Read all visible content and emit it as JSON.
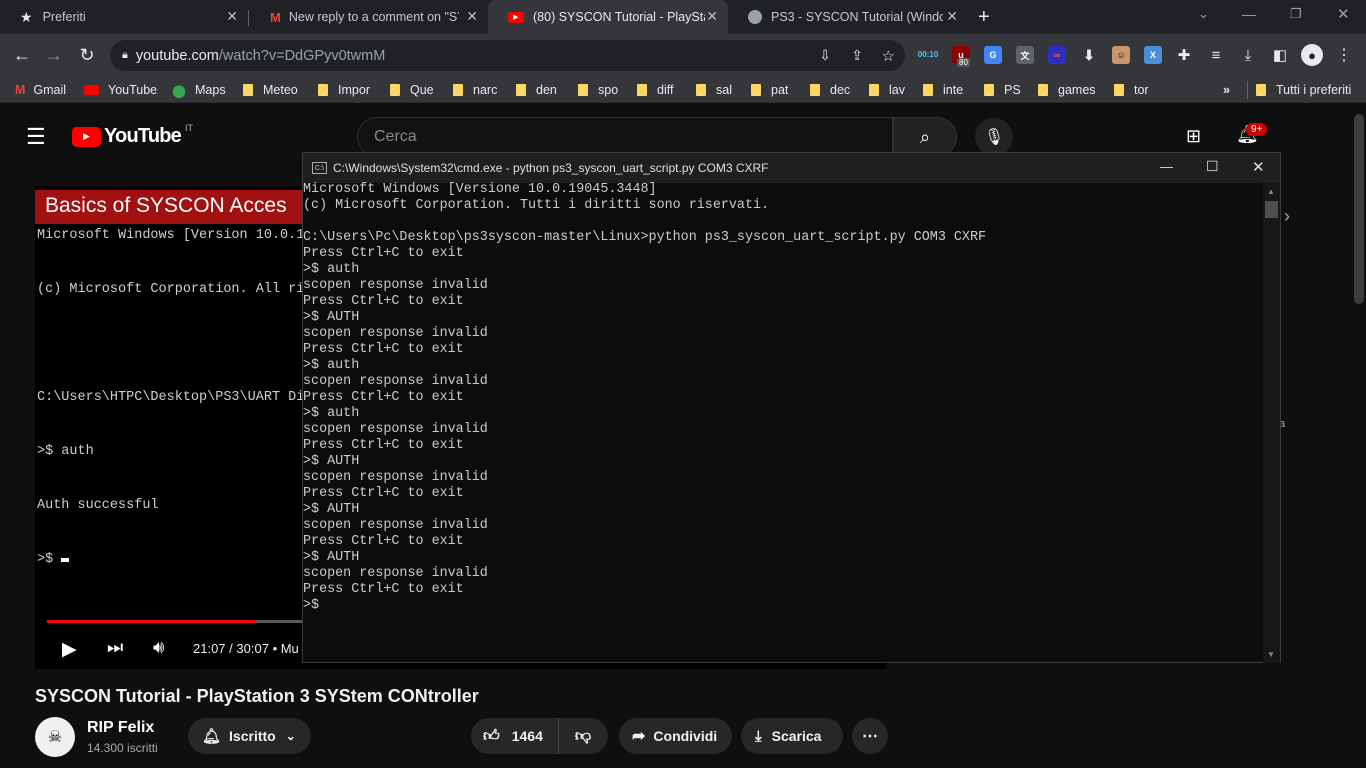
{
  "browser": {
    "tabs": [
      {
        "title": "Preferiti",
        "icon": "star-icon"
      },
      {
        "title": "New reply to a comment on \"SY",
        "icon": "gmail-icon"
      },
      {
        "title": "(80) SYSCON Tutorial - PlayStatio",
        "icon": "youtube-icon"
      },
      {
        "title": "PS3 - SYSCON Tutorial (Window",
        "icon": "globe-icon"
      }
    ],
    "new_tab": "+",
    "url_host": "youtube.com",
    "url_path": "/watch?v=DdGPyv0twmM",
    "ext_badge_timer": "00:10",
    "ext_badge_count": "80",
    "bookmarks": [
      "Gmail",
      "YouTube",
      "Maps",
      "Meteo",
      "Impor",
      "Que",
      "narc",
      "den",
      "spo",
      "diff",
      "sal",
      "pat",
      "dec",
      "lav",
      "inte",
      "PS",
      "games",
      "tor"
    ],
    "bookmarks_more": "»",
    "bookmarks_all": "Tutti i preferiti"
  },
  "youtube": {
    "logo_text": "YouTube",
    "country_code": "IT",
    "search_placeholder": "Cerca",
    "notif_badge": "9+",
    "video_overlay_title": "Basics of SYSCON Acces",
    "video_terminal_lines": [
      "Microsoft Windows [Version 10.0.1",
      "(c) Microsoft Corporation. All ri",
      "",
      "C:\\Users\\HTPC\\Desktop\\PS3\\UART Di",
      ">$ auth",
      "Auth successful",
      ">$ "
    ],
    "time_current": "21:07",
    "time_total": "30:07",
    "time_sep": " / ",
    "chapter_partial": "• Mu",
    "progress": 0.82,
    "video_title": "SYSCON Tutorial - PlayStation 3 SYStem CONtroller",
    "channel_name": "RIP Felix",
    "subscribers": "14.300 iscritti",
    "subscribed_label": "Iscritto",
    "likes": "1464",
    "share_label": "Condividi",
    "download_label": "Scarica",
    "side_fragment": "a"
  },
  "cmd": {
    "title": "C:\\Windows\\System32\\cmd.exe - python  ps3_syscon_uart_script.py COM3 CXRF",
    "lines": [
      "Microsoft Windows [Versione 10.0.19045.3448]",
      "(c) Microsoft Corporation. Tutti i diritti sono riservati.",
      "",
      "C:\\Users\\Pc\\Desktop\\ps3syscon-master\\Linux>python ps3_syscon_uart_script.py COM3 CXRF",
      "Press Ctrl+C to exit",
      ">$ auth",
      "scopen response invalid",
      "Press Ctrl+C to exit",
      ">$ AUTH",
      "scopen response invalid",
      "Press Ctrl+C to exit",
      ">$ auth",
      "scopen response invalid",
      "Press Ctrl+C to exit",
      ">$ auth",
      "scopen response invalid",
      "Press Ctrl+C to exit",
      ">$ AUTH",
      "scopen response invalid",
      "Press Ctrl+C to exit",
      ">$ AUTH",
      "scopen response invalid",
      "Press Ctrl+C to exit",
      ">$ AUTH",
      "scopen response invalid",
      "Press Ctrl+C to exit",
      ">$"
    ]
  }
}
